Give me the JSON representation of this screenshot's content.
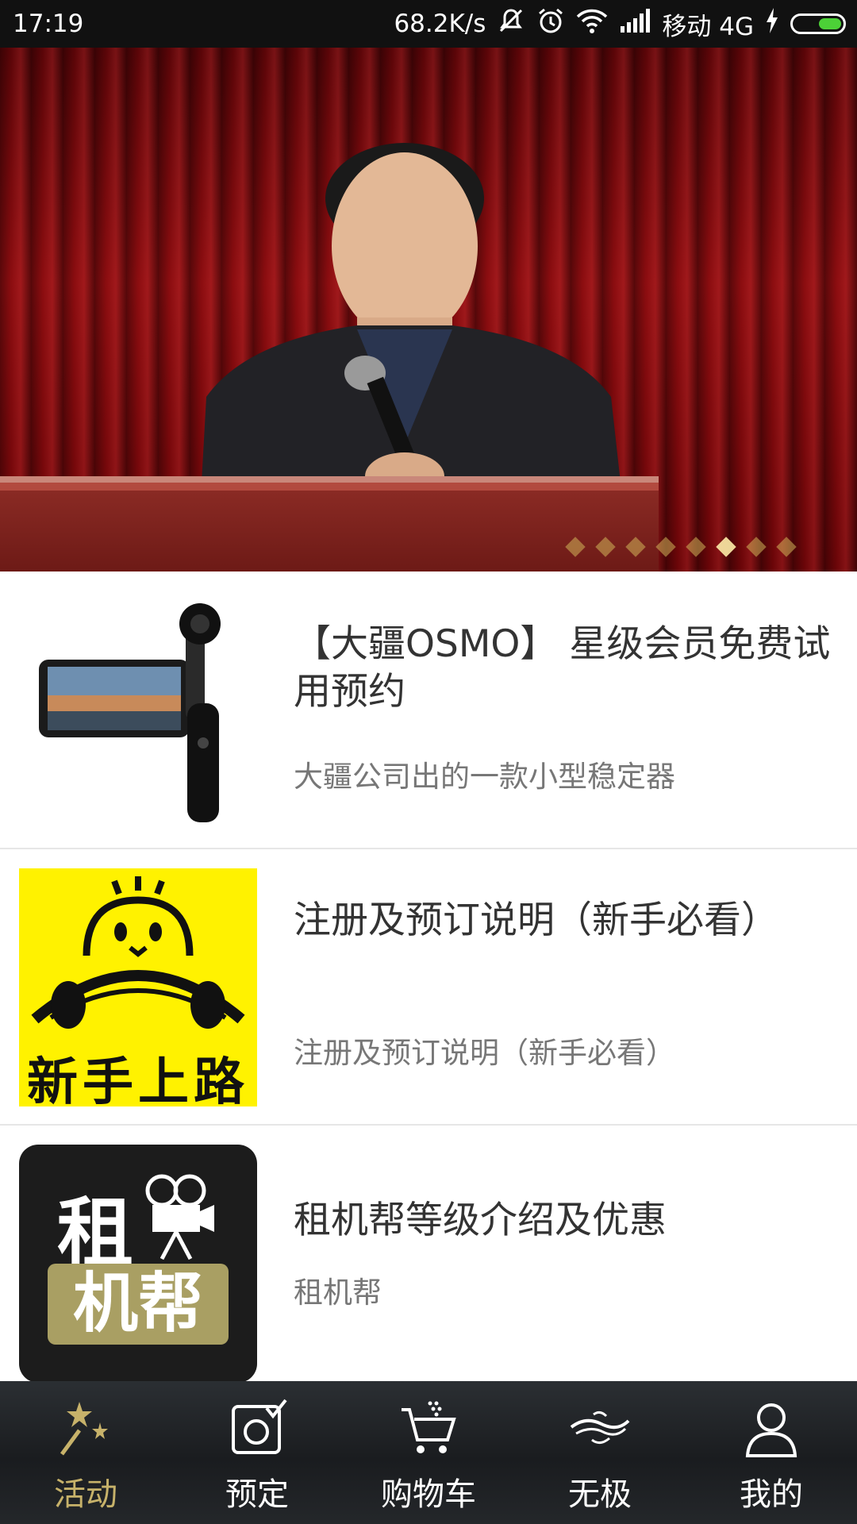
{
  "status_bar": {
    "time": "17:19",
    "speed": "68.2K/s",
    "carrier": "移动 4G",
    "icons": [
      "mute-icon",
      "alarm-icon",
      "wifi-icon",
      "signal-icon",
      "charging-icon",
      "battery-icon"
    ]
  },
  "banner": {
    "slide_count": 8,
    "active_index": 5
  },
  "list": [
    {
      "title": "【大疆OSMO】 星级会员免费试用预约",
      "subtitle": "大疆公司出的一款小型稳定器",
      "thumb": "osmo-gimbal-image"
    },
    {
      "title": "注册及预订说明（新手必看）",
      "subtitle": "注册及预订说明（新手必看）",
      "thumb": "newbie-logo-image",
      "thumb_text": "新手上路"
    },
    {
      "title": "租机帮等级介绍及优惠",
      "subtitle": "租机帮",
      "thumb": "zujibang-logo-image",
      "thumb_text_top": "租",
      "thumb_text_bottom": "机帮"
    }
  ],
  "bottom_nav": [
    {
      "label": "活动",
      "icon": "sparkle-wand-icon",
      "active": true
    },
    {
      "label": "预定",
      "icon": "camera-check-icon",
      "active": false
    },
    {
      "label": "购物车",
      "icon": "cart-icon",
      "active": false
    },
    {
      "label": "无极",
      "icon": "wuji-logo-icon",
      "active": false
    },
    {
      "label": "我的",
      "icon": "user-icon",
      "active": false
    }
  ],
  "colors": {
    "status_bar_bg": "#111111",
    "nav_active": "#c7b26a",
    "nav_bg": "#1f2225",
    "title_text": "#333333",
    "subtitle_text": "#777777"
  }
}
